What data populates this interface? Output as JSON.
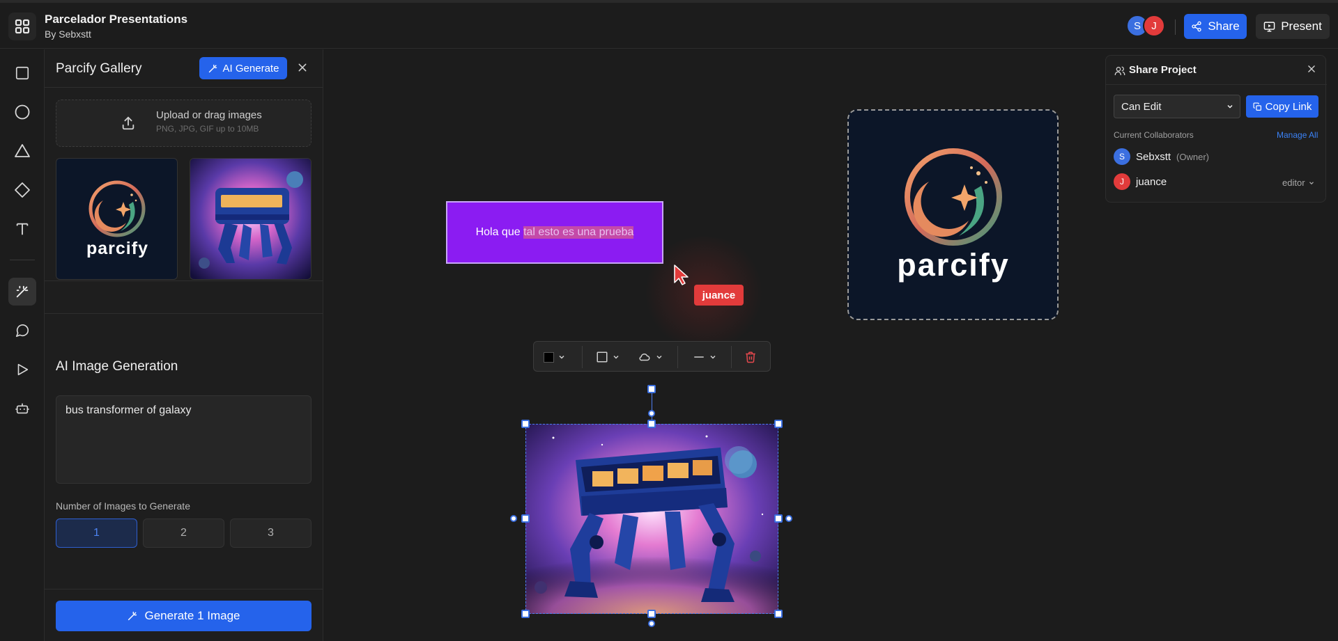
{
  "header": {
    "title": "Parcelador Presentations",
    "subtitle": "By Sebxstt",
    "avatars": [
      "S",
      "J"
    ],
    "share_label": "Share",
    "present_label": "Present"
  },
  "toolbar": {
    "tools": [
      "rectangle-icon",
      "circle-icon",
      "triangle-icon",
      "diamond-icon",
      "text-icon",
      "magic-wand-icon",
      "comment-icon",
      "play-icon",
      "robot-icon"
    ],
    "active": "magic-wand-icon"
  },
  "gallery": {
    "title": "Parcify Gallery",
    "ai_generate_label": "AI Generate",
    "upload_label": "Upload or drag images",
    "upload_hint": "PNG, JPG, GIF up to 10MB",
    "thumbnails": [
      "parcify-logo",
      "bus-transformer"
    ],
    "logo_word": "parcify"
  },
  "ai_generation": {
    "title": "AI Image Generation",
    "prompt": "bus transformer of galaxy",
    "count_label": "Number of Images to Generate",
    "counts": [
      "1",
      "2",
      "3"
    ],
    "selected_count": "1",
    "generate_label": "Generate 1 Image"
  },
  "canvas": {
    "text_box": {
      "text_plain": "Hola que ",
      "text_highlighted": "tal esto es una prueba",
      "fill": "#8b1cf2"
    },
    "remote_cursor": {
      "name": "juance",
      "color": "#e23b3b"
    },
    "logo_word": "parcify"
  },
  "share": {
    "title": "Share Project",
    "permission": "Can Edit",
    "permission_options": [
      "Can Edit"
    ],
    "copy_link_label": "Copy Link",
    "collaborators_label": "Current Collaborators",
    "manage_label": "Manage All",
    "collaborators": [
      {
        "initial": "S",
        "name": "Sebxstt",
        "tag": "(Owner)",
        "color": "#3b6fe0"
      },
      {
        "initial": "J",
        "name": "juance",
        "role": "editor",
        "color": "#e23b3b"
      }
    ]
  },
  "colors": {
    "accent": "#2563eb",
    "background": "#1c1c1c",
    "danger": "#e23b3b"
  }
}
